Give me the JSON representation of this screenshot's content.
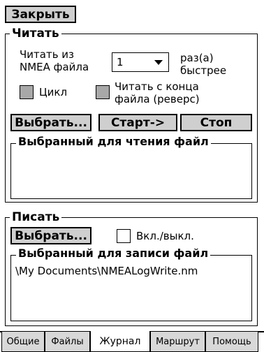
{
  "close_button": "Закрыть",
  "read": {
    "legend": "Читать",
    "read_from_line1": "Читать из",
    "read_from_line2": "NMEA файла",
    "speed_value": "1",
    "times_line1": "раз(а)",
    "times_line2": "быстрее",
    "loop_label": "Цикл",
    "reverse_line1": "Читать с конца",
    "reverse_line2": "файла (реверс)",
    "select_button": "Выбрать...",
    "start_button": "Старт->",
    "stop_button": "Стоп",
    "selected_file_legend": "Выбранный для чтения файл",
    "selected_file_value": ""
  },
  "write": {
    "legend": "Писать",
    "select_button": "Выбрать...",
    "toggle_label": "Вкл./выкл.",
    "selected_file_legend": "Выбранный для записи файл",
    "selected_file_value": "\\My Documents\\NMEALogWrite.nm"
  },
  "tabs": [
    {
      "label": "Общие"
    },
    {
      "label": "Файлы"
    },
    {
      "label": "Журнал"
    },
    {
      "label": "Маршрут"
    },
    {
      "label": "Помощь"
    }
  ],
  "colors": {
    "button_bg": "#cfcfcf",
    "checkbox_gray": "#a8a8a8",
    "tab_bg": "#d8d8d8"
  }
}
